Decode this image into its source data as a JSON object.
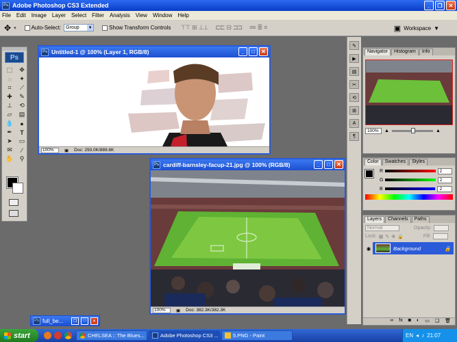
{
  "app": {
    "title": "Adobe Photoshop CS3 Extended",
    "logo": "Ps"
  },
  "menu": [
    "File",
    "Edit",
    "Image",
    "Layer",
    "Select",
    "Filter",
    "Analysis",
    "View",
    "Window",
    "Help"
  ],
  "options": {
    "auto_select_label": "Auto-Select:",
    "auto_select_value": "Group",
    "show_transform_label": "Show Transform Controls",
    "workspace_label": "Workspace"
  },
  "doc1": {
    "title": "Untitled-1 @ 100% (Layer 1, RGB/8)",
    "zoom": "100%",
    "info": "Doc: 293.0K/889.6K"
  },
  "doc2": {
    "title": "cardiff-barnsley-facup-21.jpg @ 100% (RGB/8)",
    "zoom": "100%",
    "info": "Doc: 382.3K/382.3K"
  },
  "minimized_doc": {
    "title": "full_be..."
  },
  "navigator": {
    "tabs": [
      "Navigator",
      "Histogram",
      "Info"
    ],
    "zoom": "100%"
  },
  "color_panel": {
    "tabs": [
      "Color",
      "Swatches",
      "Styles"
    ],
    "channels": [
      {
        "label": "R",
        "value": "2",
        "color": "#d01010"
      },
      {
        "label": "G",
        "value": "2",
        "color": "#10b010"
      },
      {
        "label": "B",
        "value": "2",
        "color": "#1020d0"
      }
    ]
  },
  "layers_panel": {
    "tabs": [
      "Layers",
      "Channels",
      "Paths"
    ],
    "blend_mode": "Normal",
    "opacity_label": "Opacity:",
    "lock_label": "Lock:",
    "fill_label": "Fill:",
    "layer_name": "Background"
  },
  "taskbar": {
    "start": "start",
    "tasks": [
      {
        "label": "CHELSEA :: The Blues...",
        "active": false
      },
      {
        "label": "Adobe Photoshop CS3 ...",
        "active": true
      },
      {
        "label": "5.PNG - Paint",
        "active": false
      }
    ],
    "lang": "EN",
    "clock": "21:07"
  },
  "colors": {
    "xp_blue": "#0a3cc8",
    "panel_gray": "#d4d0c8",
    "canvas_gray": "#6b6b6b"
  }
}
